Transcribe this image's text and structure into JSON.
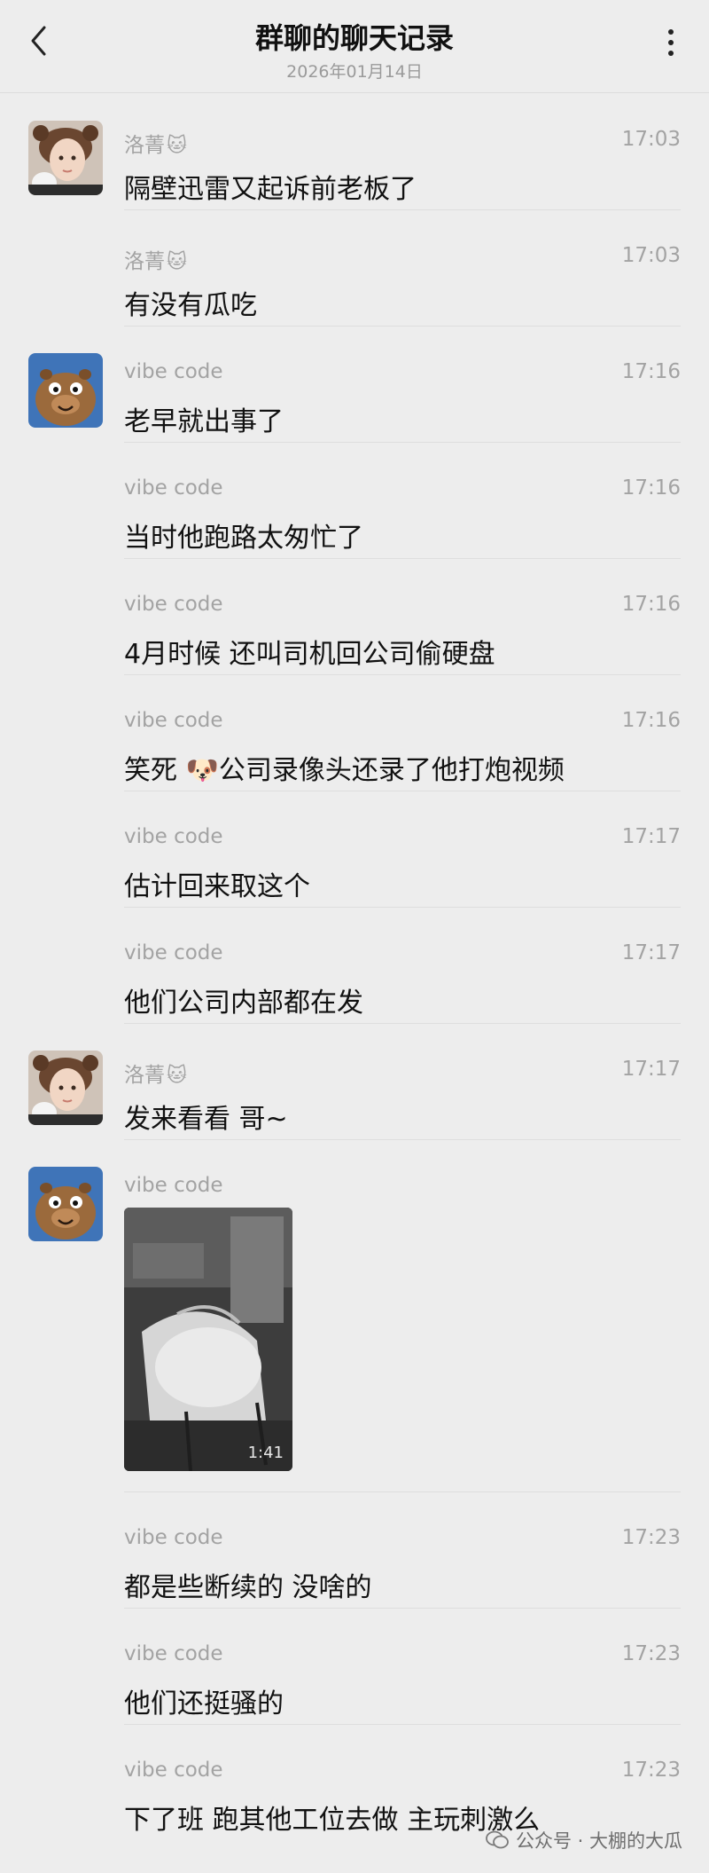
{
  "header": {
    "title": "群聊的聊天记录",
    "date": "2026年01月14日"
  },
  "messages": [
    {
      "sender": "洛菁",
      "sender_emoji": "🐱",
      "time": "17:03",
      "text": "隔壁迅雷又起诉前老板了",
      "avatar": "girl-avatar"
    },
    {
      "sender": "洛菁",
      "sender_emoji": "🐱",
      "time": "17:03",
      "text": "有没有瓜吃"
    },
    {
      "sender": "vibe code",
      "time": "17:16",
      "text": "老早就出事了",
      "avatar": "capybara-avatar"
    },
    {
      "sender": "vibe code",
      "time": "17:16",
      "text": "当时他跑路太匆忙了"
    },
    {
      "sender": "vibe code",
      "time": "17:16",
      "text": "4月时候 还叫司机回公司偷硬盘"
    },
    {
      "sender": "vibe code",
      "time": "17:16",
      "text_before": "笑死 ",
      "emoji": "🐶",
      "text_after": "公司录像头还录了他打炮视频"
    },
    {
      "sender": "vibe code",
      "time": "17:17",
      "text": "估计回来取这个"
    },
    {
      "sender": "vibe code",
      "time": "17:17",
      "text": "他们公司内部都在发"
    },
    {
      "sender": "洛菁",
      "sender_emoji": "🐱",
      "time": "17:17",
      "text": "发来看看 哥~",
      "avatar": "girl-avatar"
    },
    {
      "sender": "vibe code",
      "type": "video",
      "video_duration": "1:41",
      "avatar": "capybara-avatar"
    },
    {
      "sender": "vibe code",
      "time": "17:23",
      "text": "都是些断续的 没啥的"
    },
    {
      "sender": "vibe code",
      "time": "17:23",
      "text": "他们还挺骚的"
    },
    {
      "sender": "vibe code",
      "time": "17:23",
      "text": "下了班 跑其他工位去做 主玩刺激么"
    }
  ],
  "watermark": {
    "icon": "wechat-official-account-icon",
    "text": "公众号 · 大棚的大瓜"
  }
}
